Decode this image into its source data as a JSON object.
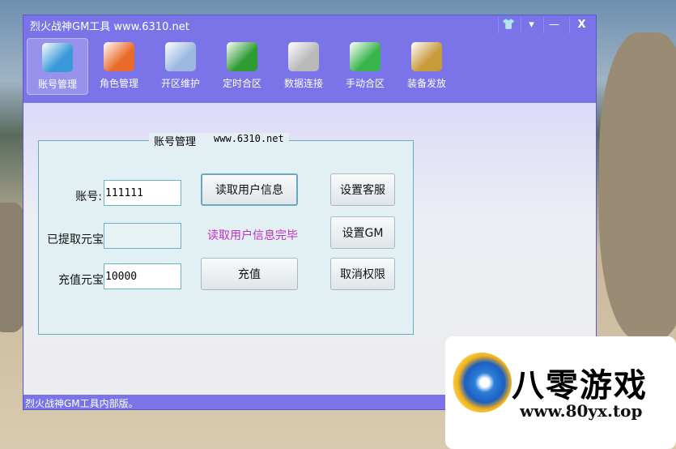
{
  "window": {
    "title": "烈火战神GM工具 www.6310.net",
    "controls": [
      "skin",
      "menu",
      "minimize",
      "close"
    ],
    "control_glyphs": [
      "👕",
      "▾",
      "—",
      "X"
    ]
  },
  "toolbar": [
    {
      "label": "账号管理",
      "icon": "monitor-pulse-icon",
      "color": "#3a9ad9",
      "active": true
    },
    {
      "label": "角色管理",
      "icon": "windows-refresh-icon",
      "color": "#e96b2a"
    },
    {
      "label": "开区维护",
      "icon": "cd-drive-icon",
      "color": "#9ab8e0"
    },
    {
      "label": "定时合区",
      "icon": "shield-clock-icon",
      "color": "#2f9b33"
    },
    {
      "label": "数据连接",
      "icon": "disk-tools-icon",
      "color": "#b9b9b9"
    },
    {
      "label": "手动合区",
      "icon": "monitor-wand-icon",
      "color": "#38b54a"
    },
    {
      "label": "装备发放",
      "icon": "briefcase-icon",
      "color": "#c79a3a"
    }
  ],
  "group": {
    "title": "账号管理",
    "url": "www.6310.net"
  },
  "form": {
    "account_label": "账号:",
    "account_value": "111111",
    "extracted_label": "已提取元宝",
    "extracted_value": "",
    "recharge_label": "充值元宝",
    "recharge_value": "10000"
  },
  "buttons": {
    "read_info": "读取用户信息",
    "recharge": "充值",
    "set_service": "设置客服",
    "set_gm": "设置GM",
    "revoke": "取消权限"
  },
  "message": "读取用户信息完毕",
  "status": "烈火战神GM工具内部版。",
  "ad": {
    "name": "八零游戏",
    "url": "www.80yx.top"
  }
}
